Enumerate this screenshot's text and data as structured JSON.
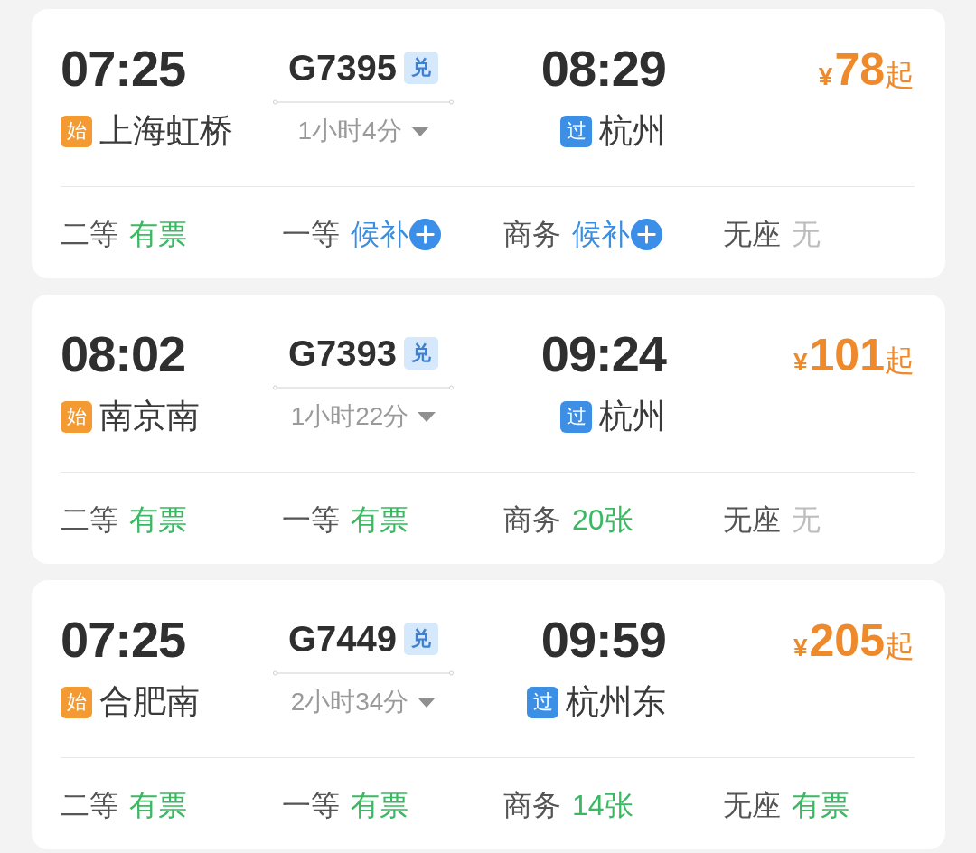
{
  "trains": [
    {
      "depart_time": "07:25",
      "origin_badge": "始",
      "origin": "上海虹桥",
      "train_number": "G7395",
      "exchange_badge": "兑",
      "duration": "1小时4分",
      "arrive_time": "08:29",
      "destination_badge": "过",
      "destination": "杭州",
      "price": {
        "currency": "¥",
        "amount": "78",
        "suffix": "起"
      },
      "seats": [
        {
          "class": "二等",
          "availability": "有票",
          "kind": "available"
        },
        {
          "class": "一等",
          "availability": "候补",
          "kind": "waitlist"
        },
        {
          "class": "商务",
          "availability": "候补",
          "kind": "waitlist"
        },
        {
          "class": "无座",
          "availability": "无",
          "kind": "none"
        }
      ]
    },
    {
      "depart_time": "08:02",
      "origin_badge": "始",
      "origin": "南京南",
      "train_number": "G7393",
      "exchange_badge": "兑",
      "duration": "1小时22分",
      "arrive_time": "09:24",
      "destination_badge": "过",
      "destination": "杭州",
      "price": {
        "currency": "¥",
        "amount": "101",
        "suffix": "起"
      },
      "seats": [
        {
          "class": "二等",
          "availability": "有票",
          "kind": "available"
        },
        {
          "class": "一等",
          "availability": "有票",
          "kind": "available"
        },
        {
          "class": "商务",
          "availability": "20张",
          "kind": "available"
        },
        {
          "class": "无座",
          "availability": "无",
          "kind": "none"
        }
      ]
    },
    {
      "depart_time": "07:25",
      "origin_badge": "始",
      "origin": "合肥南",
      "train_number": "G7449",
      "exchange_badge": "兑",
      "duration": "2小时34分",
      "arrive_time": "09:59",
      "destination_badge": "过",
      "destination": "杭州东",
      "price": {
        "currency": "¥",
        "amount": "205",
        "suffix": "起"
      },
      "seats": [
        {
          "class": "二等",
          "availability": "有票",
          "kind": "available"
        },
        {
          "class": "一等",
          "availability": "有票",
          "kind": "available"
        },
        {
          "class": "商务",
          "availability": "14张",
          "kind": "available"
        },
        {
          "class": "无座",
          "availability": "有票",
          "kind": "available"
        }
      ]
    }
  ]
}
